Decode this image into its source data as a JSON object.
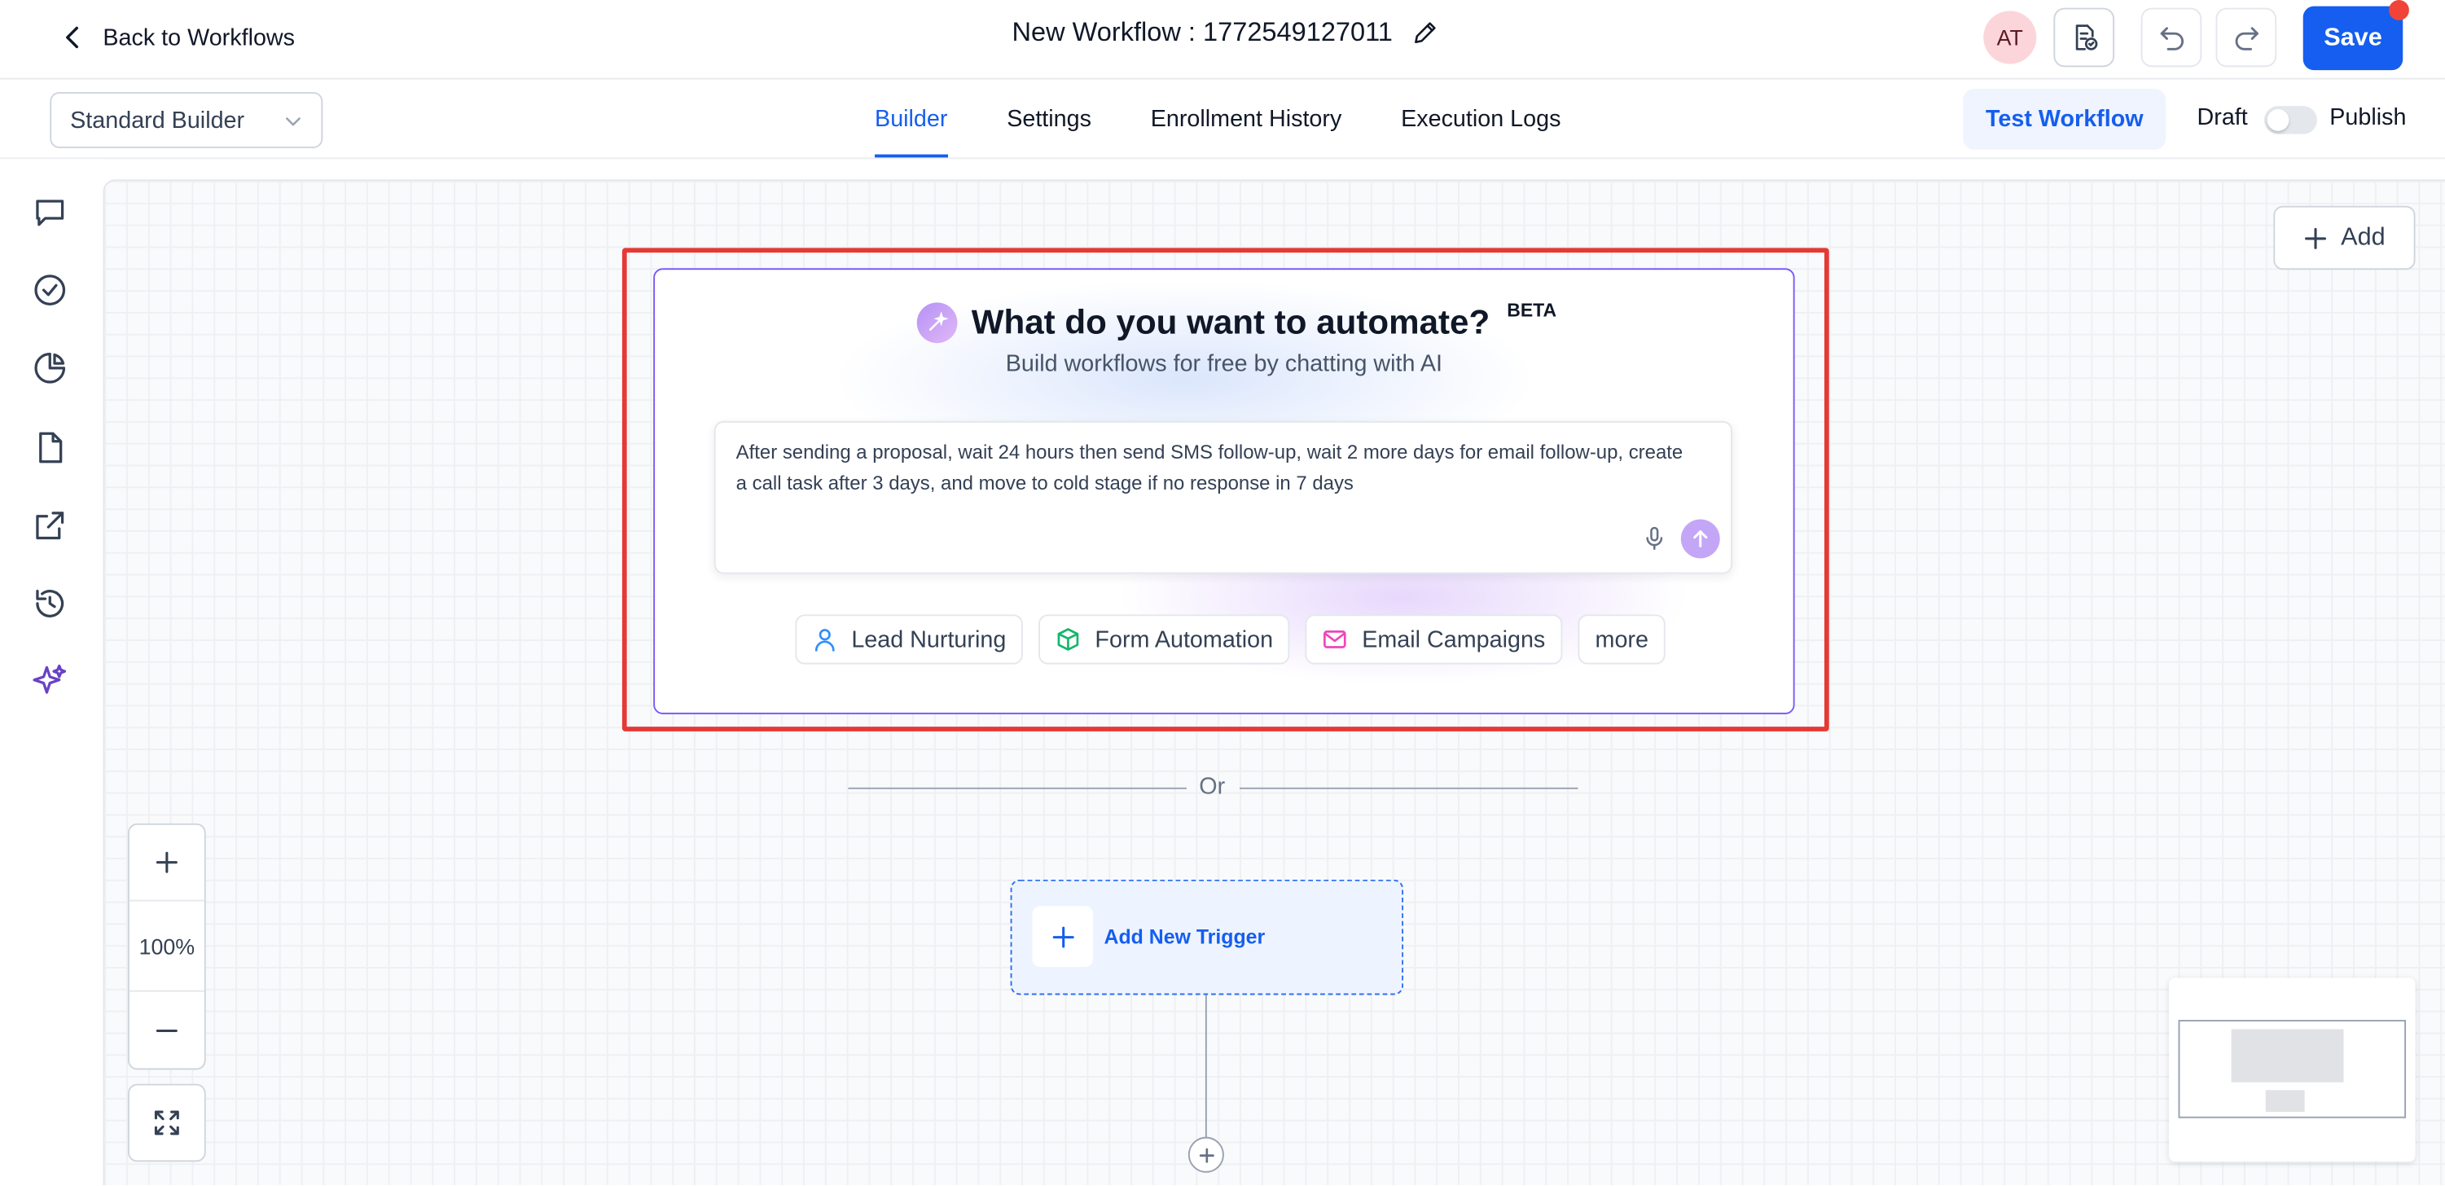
{
  "header": {
    "back_label": "Back to Workflows",
    "workflow_title": "New Workflow : 1772549127011",
    "avatar_initials": "AT",
    "save_label": "Save"
  },
  "subbar": {
    "builder_mode": "Standard Builder",
    "tabs": [
      {
        "label": "Builder",
        "active": true
      },
      {
        "label": "Settings",
        "active": false
      },
      {
        "label": "Enrollment History",
        "active": false
      },
      {
        "label": "Execution Logs",
        "active": false
      }
    ],
    "test_label": "Test Workflow",
    "draft_label": "Draft",
    "publish_label": "Publish",
    "published": false
  },
  "rail": {
    "icons": [
      "chat-icon",
      "check-circle-icon",
      "pie-chart-icon",
      "document-icon",
      "external-link-icon",
      "history-icon",
      "sparkle-icon"
    ]
  },
  "canvas": {
    "add_label": "Add",
    "ai": {
      "title": "What do you want to automate?",
      "badge": "BETA",
      "subtitle": "Build workflows for free by chatting with AI",
      "prompt": "After sending a proposal, wait 24 hours then send SMS follow-up, wait 2 more days for email follow-up, create a call task after 3 days, and move to cold stage if no response in 7 days",
      "chips": [
        {
          "label": "Lead Nurturing",
          "icon": "user-icon"
        },
        {
          "label": "Form Automation",
          "icon": "cube-icon"
        },
        {
          "label": "Email Campaigns",
          "icon": "mail-icon"
        },
        {
          "label": "more",
          "icon": ""
        }
      ]
    },
    "or_label": "Or",
    "zoom_level": "100%",
    "trigger_label": "Add New Trigger"
  },
  "colors": {
    "primary": "#155eef",
    "highlight": "#e53935",
    "ai_border": "#7a5af8",
    "rail_active": "#6941c6"
  }
}
